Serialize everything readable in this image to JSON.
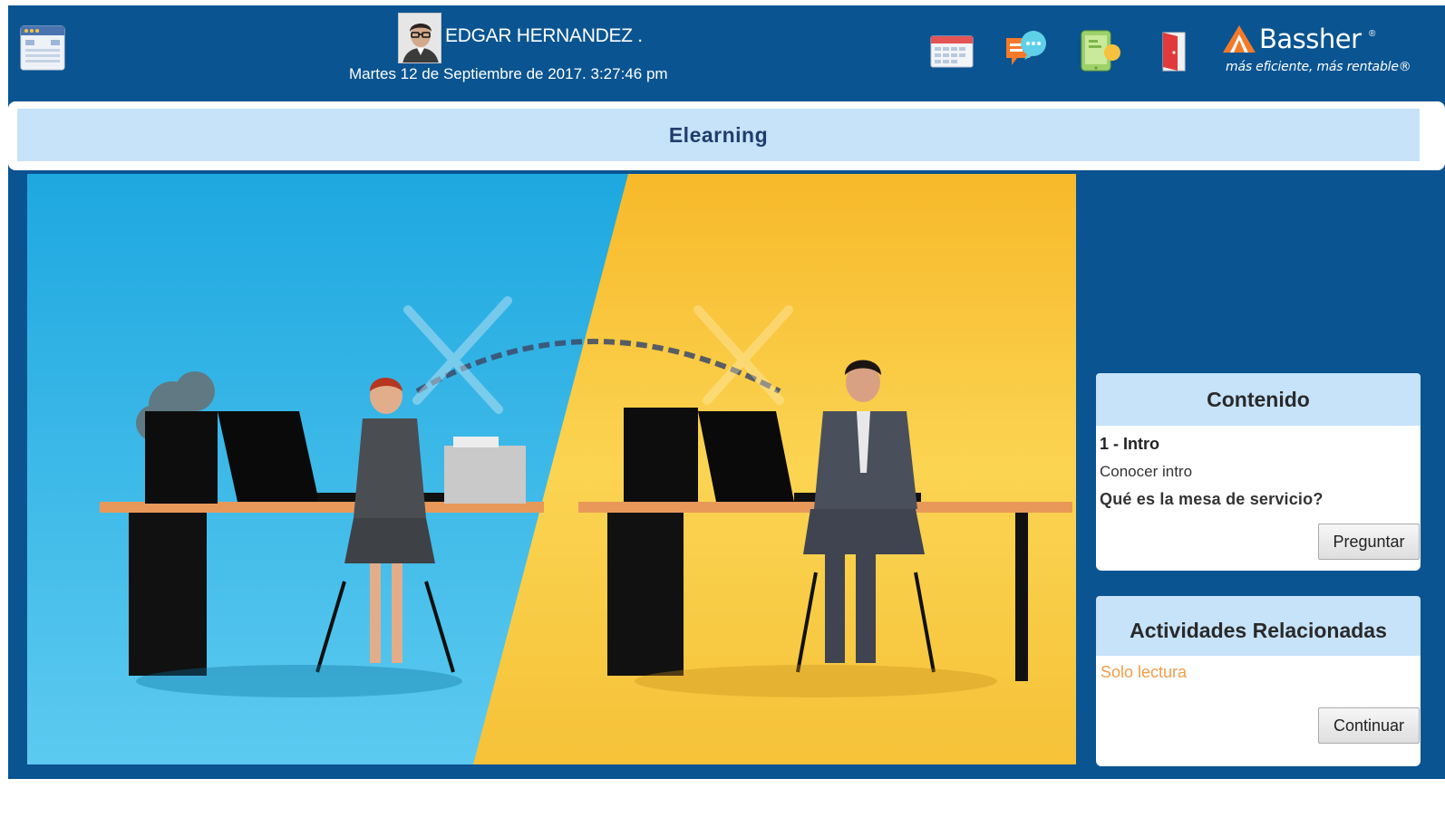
{
  "header": {
    "user_name": "EDGAR HERNANDEZ .",
    "date": "Martes 12 de Septiembre de 2017. 3:27:46 pm",
    "icons": [
      "menu-window-icon",
      "calendar-icon",
      "chat-bubbles-icon",
      "tablet-icon",
      "exit-door-icon"
    ],
    "logo": {
      "name": "Bassher",
      "reg": "®",
      "tagline": "más eficiente, más rentable®"
    }
  },
  "title": "Elearning",
  "contenido": {
    "heading": "Contenido",
    "lesson_number": "1 - Intro",
    "lesson_description": "Conocer intro",
    "question": "Qué es la mesa de servicio?",
    "button": "Preguntar"
  },
  "actividades": {
    "heading": "Actividades Relacionadas",
    "status": "Solo lectura",
    "button": "Continuar"
  },
  "colors": {
    "primary_blue": "#0a5491",
    "panel_header": "#c6e3fa",
    "status_orange": "#f29d4a",
    "video_left": "#2cb1e4",
    "video_right": "#f7c13b"
  }
}
